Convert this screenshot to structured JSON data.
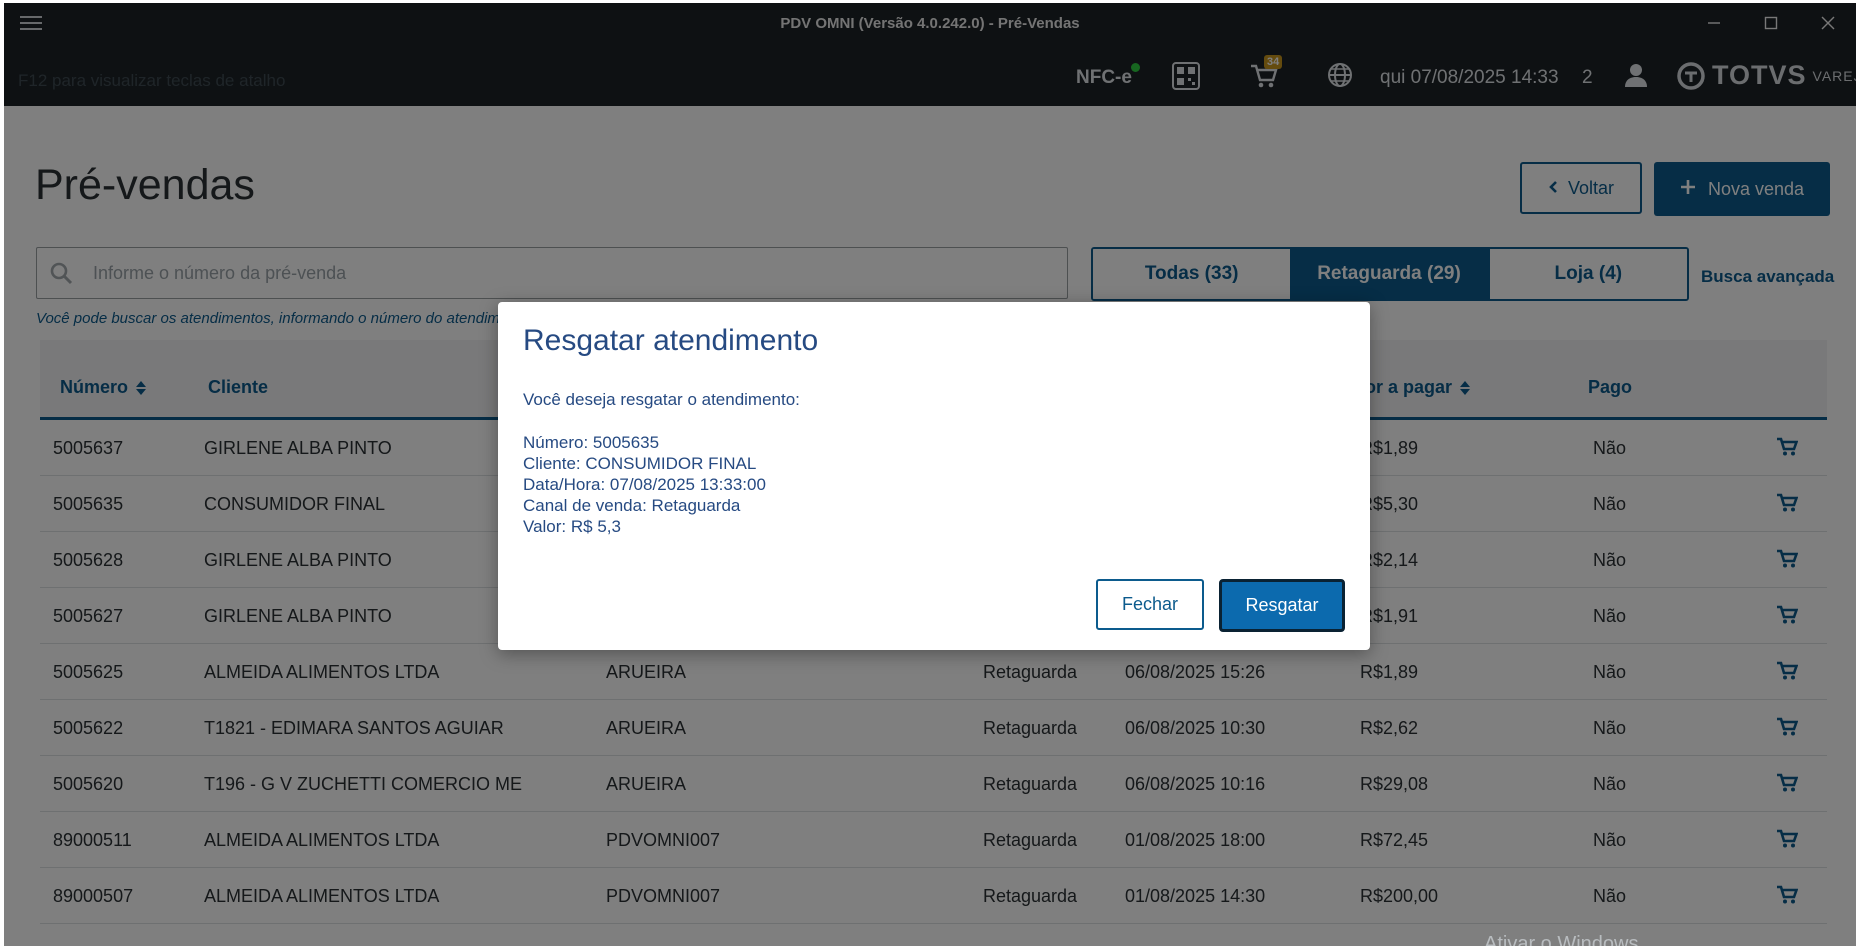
{
  "window": {
    "title": "PDV OMNI (Versão 4.0.242.0) - Pré-Vendas"
  },
  "topbar": {
    "shortcut_hint": "F12 para visualizar teclas de atalho",
    "nfce_label": "NFC-e",
    "cart_badge": "34",
    "datetime": "qui 07/08/2025 14:33",
    "count": "2",
    "brand": "TOTVS",
    "brand_sub": "VAREJO"
  },
  "page": {
    "title": "Pré-vendas",
    "back_label": "Voltar",
    "new_sale_label": "Nova venda",
    "search_placeholder": "Informe o número da pré-venda",
    "search_help": "Você pode buscar os atendimentos, informando o número do atendim",
    "tabs": [
      {
        "label": "Todas (33)",
        "active": false
      },
      {
        "label": "Retaguarda (29)",
        "active": true
      },
      {
        "label": "Loja (4)",
        "active": false
      }
    ],
    "advanced_search": "Busca avançada"
  },
  "table": {
    "headers": [
      "Número",
      "Cliente",
      "alor a pagar",
      "Pago"
    ],
    "rows": [
      {
        "numero": "5005637",
        "cliente": "GIRLENE ALBA PINTO",
        "origem": "",
        "canal": "",
        "data": "",
        "valor": "R$1,89",
        "pago": "Não"
      },
      {
        "numero": "5005635",
        "cliente": "CONSUMIDOR FINAL",
        "origem": "",
        "canal": "",
        "data": "",
        "valor": "R$5,30",
        "pago": "Não"
      },
      {
        "numero": "5005628",
        "cliente": "GIRLENE ALBA PINTO",
        "origem": "",
        "canal": "",
        "data": "",
        "valor": "R$2,14",
        "pago": "Não"
      },
      {
        "numero": "5005627",
        "cliente": "GIRLENE ALBA PINTO",
        "origem": "",
        "canal": "",
        "data": "",
        "valor": "R$1,91",
        "pago": "Não"
      },
      {
        "numero": "5005625",
        "cliente": "ALMEIDA ALIMENTOS LTDA",
        "origem": "ARUEIRA",
        "canal": "Retaguarda",
        "data": "06/08/2025 15:26",
        "valor": "R$1,89",
        "pago": "Não"
      },
      {
        "numero": "5005622",
        "cliente": "T1821 - EDIMARA SANTOS AGUIAR",
        "origem": "ARUEIRA",
        "canal": "Retaguarda",
        "data": "06/08/2025 10:30",
        "valor": "R$2,62",
        "pago": "Não"
      },
      {
        "numero": "5005620",
        "cliente": "T196 - G V ZUCHETTI COMERCIO ME",
        "origem": "ARUEIRA",
        "canal": "Retaguarda",
        "data": "06/08/2025 10:16",
        "valor": "R$29,08",
        "pago": "Não"
      },
      {
        "numero": "89000511",
        "cliente": "ALMEIDA ALIMENTOS LTDA",
        "origem": "PDVOMNI007",
        "canal": "Retaguarda",
        "data": "01/08/2025 18:00",
        "valor": "R$72,45",
        "pago": "Não"
      },
      {
        "numero": "89000507",
        "cliente": "ALMEIDA ALIMENTOS LTDA",
        "origem": "PDVOMNI007",
        "canal": "Retaguarda",
        "data": "01/08/2025 14:30",
        "valor": "R$200,00",
        "pago": "Não"
      }
    ]
  },
  "modal": {
    "title": "Resgatar atendimento",
    "question": "Você deseja resgatar o atendimento:",
    "lines": [
      "Número: 5005635",
      "Cliente: CONSUMIDOR FINAL",
      "Data/Hora: 07/08/2025 13:33:00",
      "Canal de venda: Retaguarda",
      "Valor: R$ 5,3"
    ],
    "close_label": "Fechar",
    "confirm_label": "Resgatar"
  },
  "os": {
    "watermark": "Ativar o Windows"
  },
  "colors": {
    "primary": "#0c5b8d",
    "header_bg": "#1d2327",
    "modal_text": "#264a82"
  }
}
